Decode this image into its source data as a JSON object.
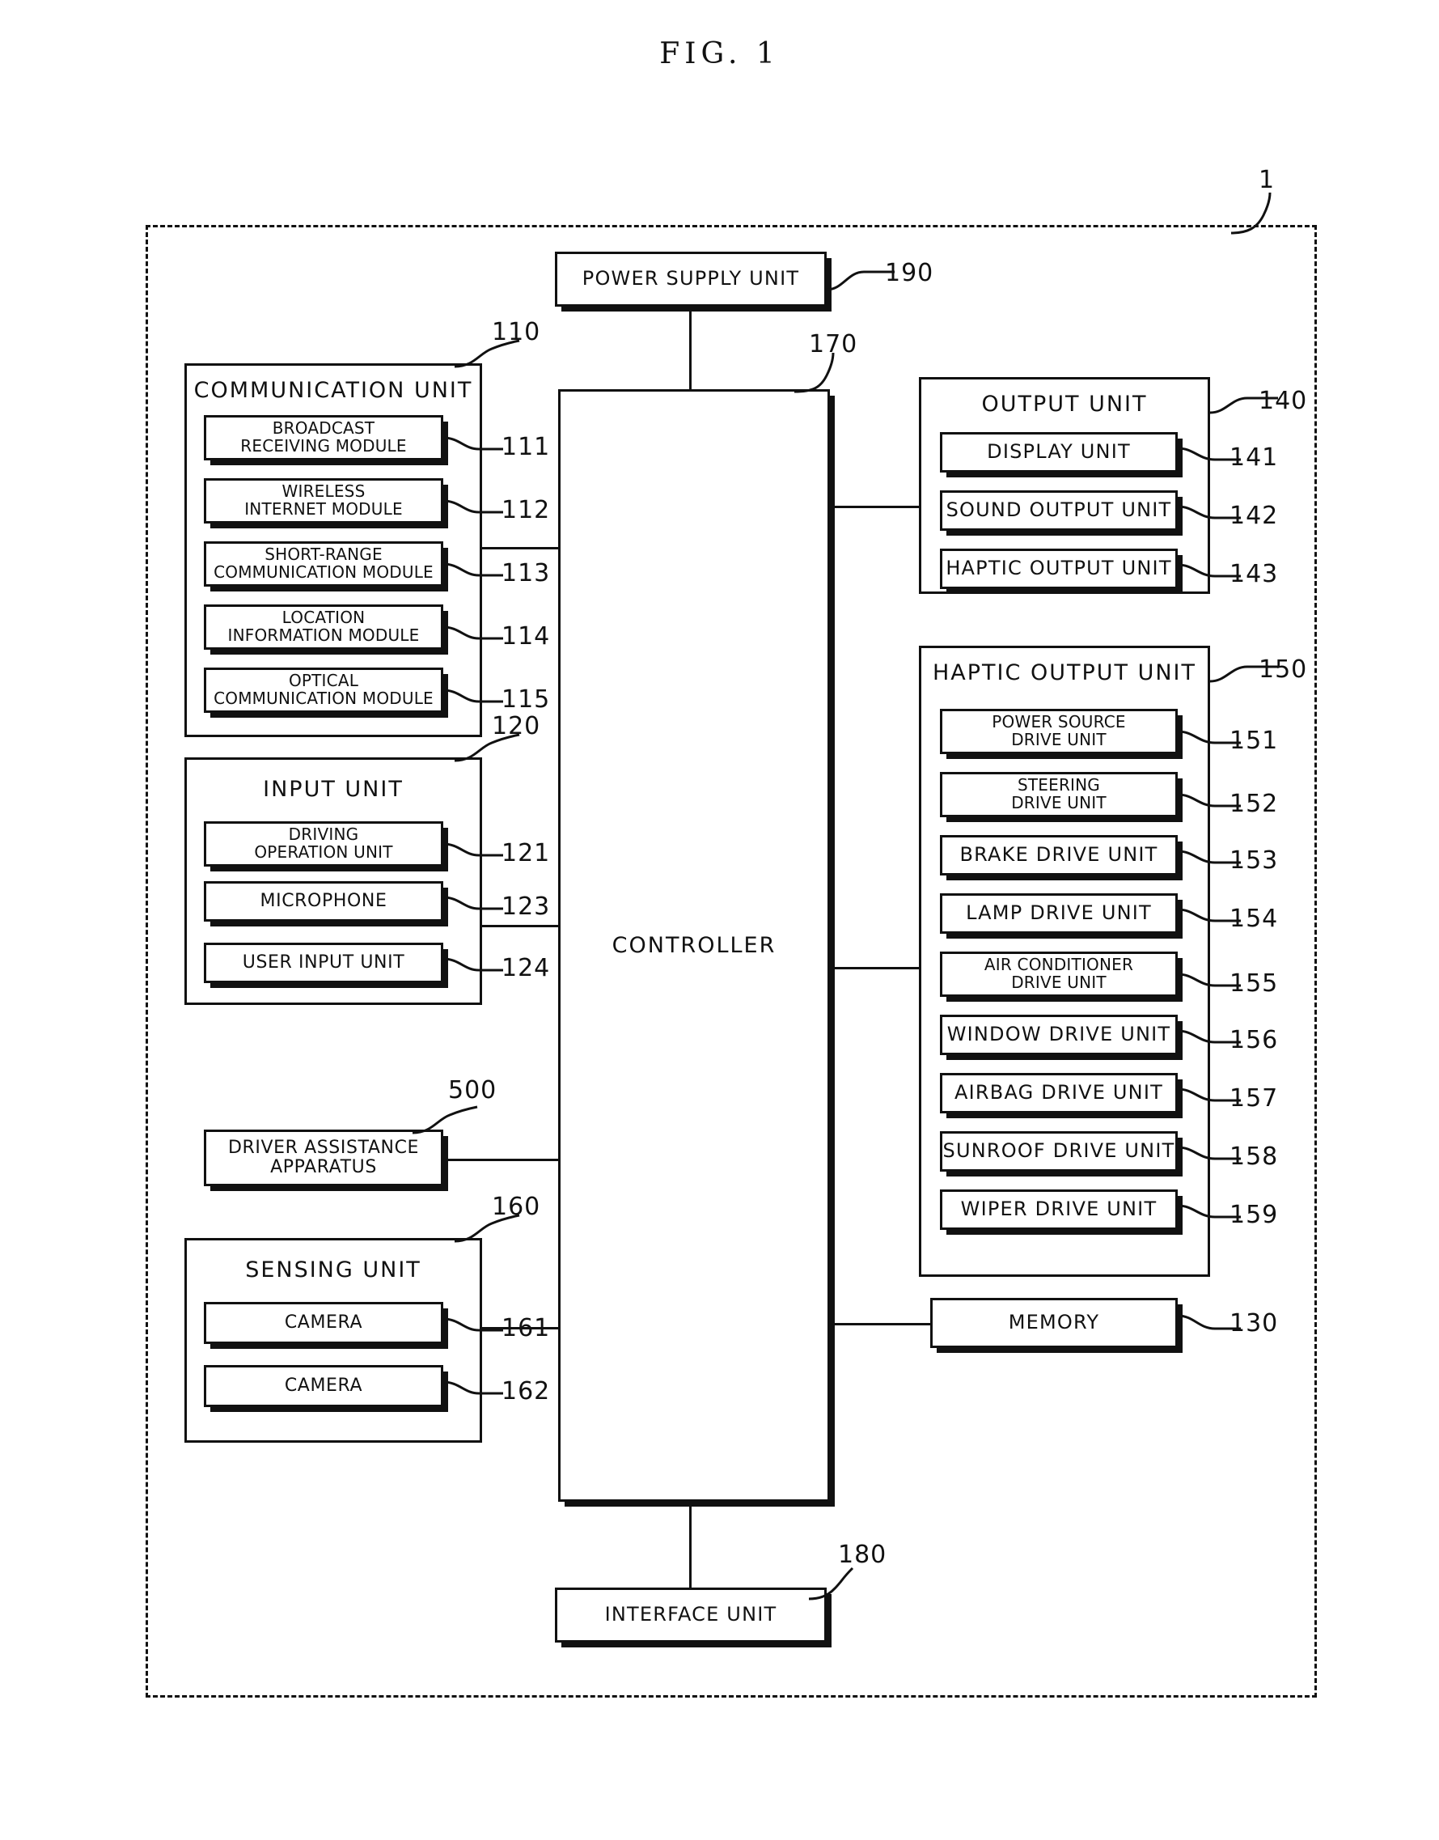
{
  "figure": {
    "caption": "FIG. 1",
    "system_ref": "1"
  },
  "power_supply": {
    "label": "POWER SUPPLY UNIT",
    "ref": "190"
  },
  "controller": {
    "label": "CONTROLLER",
    "ref": "170"
  },
  "interface": {
    "label": "INTERFACE UNIT",
    "ref": "180"
  },
  "memory": {
    "label": "MEMORY",
    "ref": "130"
  },
  "driver_assistance": {
    "label_line1": "DRIVER ASSISTANCE",
    "label_line2": "APPARATUS",
    "ref": "500"
  },
  "communication_unit": {
    "title": "COMMUNICATION UNIT",
    "ref": "110",
    "modules": [
      {
        "line1": "BROADCAST",
        "line2": "RECEIVING MODULE",
        "ref": "111"
      },
      {
        "line1": "WIRELESS",
        "line2": "INTERNET MODULE",
        "ref": "112"
      },
      {
        "line1": "SHORT-RANGE",
        "line2": "COMMUNICATION MODULE",
        "ref": "113"
      },
      {
        "line1": "LOCATION",
        "line2": "INFORMATION MODULE",
        "ref": "114"
      },
      {
        "line1": "OPTICAL",
        "line2": "COMMUNICATION MODULE",
        "ref": "115"
      }
    ]
  },
  "input_unit": {
    "title": "INPUT UNIT",
    "ref": "120",
    "modules": [
      {
        "line1": "DRIVING",
        "line2": "OPERATION UNIT",
        "ref": "121"
      },
      {
        "line1": "MICROPHONE",
        "line2": "",
        "ref": "123"
      },
      {
        "line1": "USER INPUT UNIT",
        "line2": "",
        "ref": "124"
      }
    ]
  },
  "sensing_unit": {
    "title": "SENSING UNIT",
    "ref": "160",
    "modules": [
      {
        "line1": "CAMERA",
        "line2": "",
        "ref": "161"
      },
      {
        "line1": "CAMERA",
        "line2": "",
        "ref": "162"
      }
    ]
  },
  "output_unit": {
    "title": "OUTPUT UNIT",
    "ref": "140",
    "modules": [
      {
        "line1": "DISPLAY UNIT",
        "line2": "",
        "ref": "141"
      },
      {
        "line1": "SOUND OUTPUT UNIT",
        "line2": "",
        "ref": "142"
      },
      {
        "line1": "HAPTIC OUTPUT UNIT",
        "line2": "",
        "ref": "143"
      }
    ]
  },
  "haptic_output_unit": {
    "title": "HAPTIC OUTPUT UNIT",
    "ref": "150",
    "modules": [
      {
        "line1": "POWER SOURCE",
        "line2": "DRIVE UNIT",
        "ref": "151"
      },
      {
        "line1": "STEERING",
        "line2": "DRIVE UNIT",
        "ref": "152"
      },
      {
        "line1": "BRAKE DRIVE UNIT",
        "line2": "",
        "ref": "153"
      },
      {
        "line1": "LAMP DRIVE UNIT",
        "line2": "",
        "ref": "154"
      },
      {
        "line1": "AIR CONDITIONER",
        "line2": "DRIVE UNIT",
        "ref": "155"
      },
      {
        "line1": "WINDOW DRIVE UNIT",
        "line2": "",
        "ref": "156"
      },
      {
        "line1": "AIRBAG DRIVE UNIT",
        "line2": "",
        "ref": "157"
      },
      {
        "line1": "SUNROOF DRIVE UNIT",
        "line2": "",
        "ref": "158"
      },
      {
        "line1": "WIPER DRIVE UNIT",
        "line2": "",
        "ref": "159"
      }
    ]
  },
  "colors": {
    "ink": "#111111",
    "paper": "#ffffff"
  }
}
